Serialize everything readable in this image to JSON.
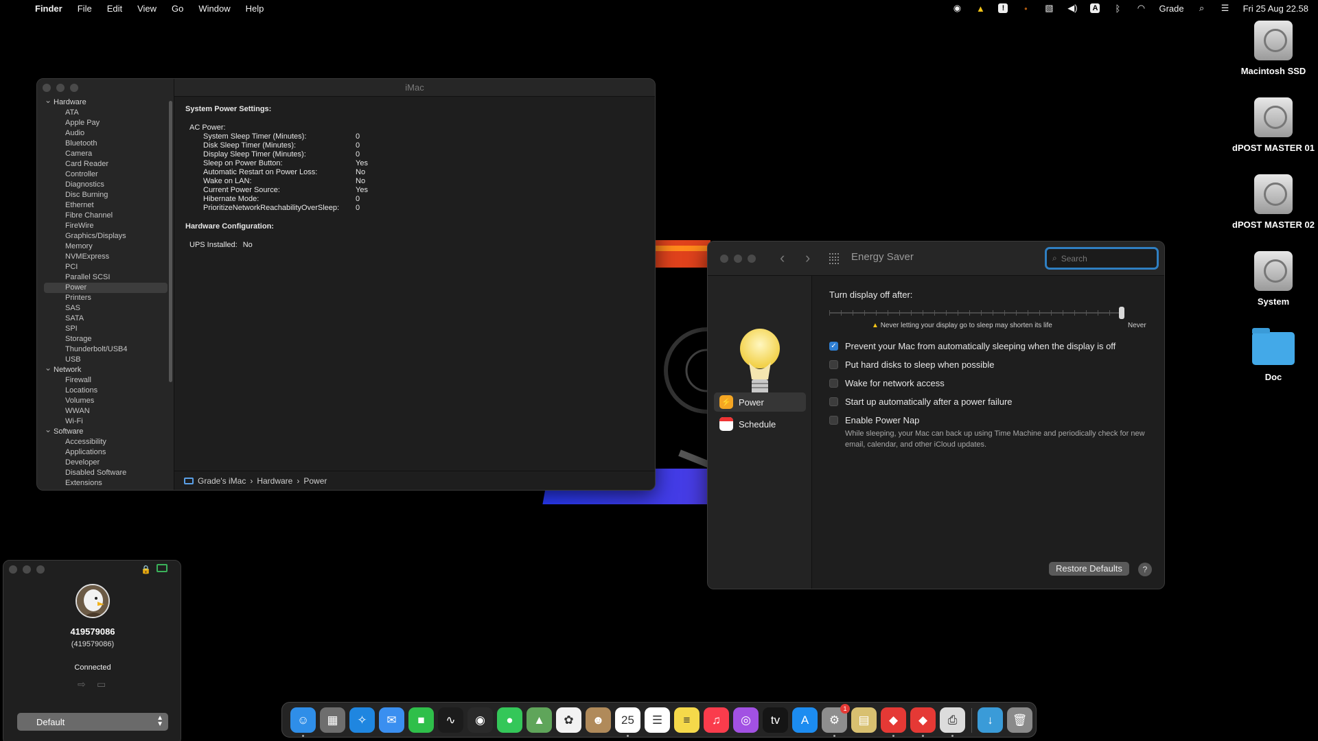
{
  "menubar": {
    "apple": "",
    "app": "Finder",
    "menus": [
      "File",
      "Edit",
      "View",
      "Go",
      "Window",
      "Help"
    ],
    "user": "Grade",
    "clock": "Fri 25 Aug  22.58",
    "status_icons": [
      "accessibility-icon",
      "warning-icon",
      "alert-icon",
      "dot-icon",
      "activity-icon",
      "volume-icon",
      "input-source-icon",
      "bluetooth-icon",
      "wifi-icon",
      "user",
      "search-icon",
      "control-center-icon"
    ]
  },
  "sysinfo": {
    "title": "iMac",
    "tree": [
      {
        "group": "Hardware",
        "items": [
          "ATA",
          "Apple Pay",
          "Audio",
          "Bluetooth",
          "Camera",
          "Card Reader",
          "Controller",
          "Diagnostics",
          "Disc Burning",
          "Ethernet",
          "Fibre Channel",
          "FireWire",
          "Graphics/Displays",
          "Memory",
          "NVMExpress",
          "PCI",
          "Parallel SCSI",
          "Power",
          "Printers",
          "SAS",
          "SATA",
          "SPI",
          "Storage",
          "Thunderbolt/USB4",
          "USB"
        ]
      },
      {
        "group": "Network",
        "items": [
          "Firewall",
          "Locations",
          "Volumes",
          "WWAN",
          "Wi-Fi"
        ]
      },
      {
        "group": "Software",
        "items": [
          "Accessibility",
          "Applications",
          "Developer",
          "Disabled Software",
          "Extensions"
        ]
      }
    ],
    "selected": "Power",
    "heading1": "System Power Settings:",
    "ac_label": "AC Power:",
    "settings": [
      {
        "k": "System Sleep Timer (Minutes):",
        "v": "0"
      },
      {
        "k": "Disk Sleep Timer (Minutes):",
        "v": "0"
      },
      {
        "k": "Display Sleep Timer (Minutes):",
        "v": "0"
      },
      {
        "k": "Sleep on Power Button:",
        "v": "Yes"
      },
      {
        "k": "Automatic Restart on Power Loss:",
        "v": "No"
      },
      {
        "k": "Wake on LAN:",
        "v": "No"
      },
      {
        "k": "Current Power Source:",
        "v": "Yes"
      },
      {
        "k": "Hibernate Mode:",
        "v": "0"
      },
      {
        "k": "PrioritizeNetworkReachabilityOverSleep:",
        "v": "0"
      }
    ],
    "heading2": "Hardware Configuration:",
    "ups_label": "UPS Installed:",
    "ups_value": "No",
    "path": [
      "Grade's iMac",
      "Hardware",
      "Power"
    ]
  },
  "energy": {
    "title": "Energy Saver",
    "search_placeholder": "Search",
    "side": [
      "Power",
      "Schedule"
    ],
    "display_label": "Turn display off after:",
    "slider_value": "Never",
    "slider_level": 1.0,
    "warning": "Never letting your display go to sleep may shorten its life",
    "options": [
      {
        "label": "Prevent your Mac from automatically sleeping when the display is off",
        "checked": true
      },
      {
        "label": "Put hard disks to sleep when possible",
        "checked": false
      },
      {
        "label": "Wake for network access",
        "checked": false
      },
      {
        "label": "Start up automatically after a power failure",
        "checked": false
      },
      {
        "label": "Enable Power Nap",
        "checked": false
      }
    ],
    "powernap_note": "While sleeping, your Mac can back up using Time Machine and periodically check for new email, calendar, and other iCloud updates.",
    "restore": "Restore Defaults",
    "help": "?"
  },
  "contact": {
    "name": "419579086",
    "sub": "(419579086)",
    "status": "Connected",
    "profile": "Default"
  },
  "desktop": [
    "Macintosh SSD",
    "dPOST MASTER 01",
    "dPOST MASTER 02",
    "System",
    "Doc"
  ],
  "dock": [
    {
      "name": "finder",
      "color": "#2f8ee8",
      "glyph": "☺"
    },
    {
      "name": "launchpad",
      "color": "#6e6e6e",
      "glyph": "▦"
    },
    {
      "name": "safari",
      "color": "#1f86e0",
      "glyph": "✧"
    },
    {
      "name": "mail",
      "color": "#3a8ff0",
      "glyph": "✉"
    },
    {
      "name": "facetime",
      "color": "#2fbf4a",
      "glyph": "■"
    },
    {
      "name": "activity",
      "color": "#1c1c1c",
      "glyph": "∿"
    },
    {
      "name": "resolve",
      "color": "#2a2a2a",
      "glyph": "◉"
    },
    {
      "name": "messages",
      "color": "#34c759",
      "glyph": "●"
    },
    {
      "name": "maps",
      "color": "#5fa55a",
      "glyph": "▲"
    },
    {
      "name": "photos",
      "color": "#f2f2f2",
      "glyph": "✿"
    },
    {
      "name": "contacts",
      "color": "#b08a5a",
      "glyph": "☻"
    },
    {
      "name": "calendar",
      "color": "#ffffff",
      "glyph": "25"
    },
    {
      "name": "reminders",
      "color": "#ffffff",
      "glyph": "☰"
    },
    {
      "name": "notes",
      "color": "#f5d94a",
      "glyph": "≡"
    },
    {
      "name": "music",
      "color": "#fa3c4c",
      "glyph": "♫"
    },
    {
      "name": "podcasts",
      "color": "#a251e3",
      "glyph": "◎"
    },
    {
      "name": "tv",
      "color": "#151515",
      "glyph": "tv"
    },
    {
      "name": "appstore",
      "color": "#1c8cf0",
      "glyph": "A"
    },
    {
      "name": "settings",
      "color": "#8e8e8e",
      "glyph": "⚙"
    },
    {
      "name": "archive",
      "color": "#d8c070",
      "glyph": "▤"
    },
    {
      "name": "anydesk",
      "color": "#e53935",
      "glyph": "◆"
    },
    {
      "name": "anydesk-2",
      "color": "#e53935",
      "glyph": "◆"
    },
    {
      "name": "printer",
      "color": "#dcdcdc",
      "glyph": "⎙"
    },
    {
      "name": "downloads",
      "color": "#3a9bd8",
      "glyph": "↓"
    },
    {
      "name": "trash",
      "color": "#8a8a8a",
      "glyph": "🗑"
    }
  ]
}
